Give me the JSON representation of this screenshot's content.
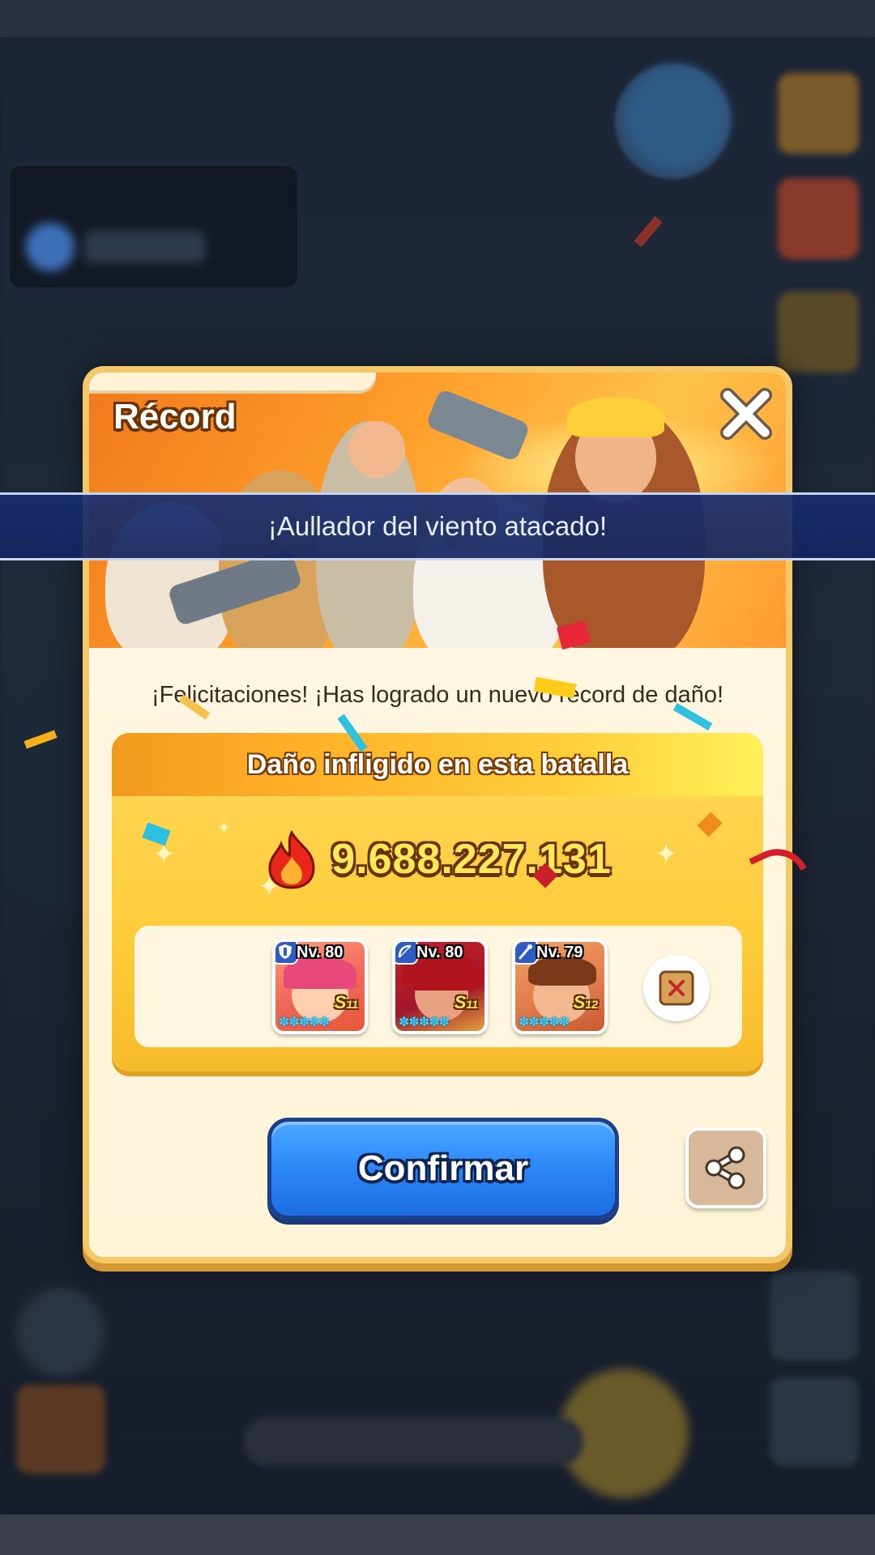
{
  "dialog": {
    "title": "Récord",
    "congrats_text": "¡Felicitaciones! ¡Has logrado un nuevo récord de daño!",
    "damage_label": "Daño infligido en esta batalla",
    "damage_value": "9.688.227.131",
    "confirm_label": "Confirmar"
  },
  "banner": {
    "text": "¡Aullador del viento atacado!"
  },
  "heroes": [
    {
      "level": "Nv. 80",
      "rank": "S",
      "rank_num": "11",
      "class_icon": "shield-icon"
    },
    {
      "level": "Nv. 80",
      "rank": "S",
      "rank_num": "11",
      "class_icon": "bow-icon"
    },
    {
      "level": "Nv. 79",
      "rank": "S",
      "rank_num": "12",
      "class_icon": "staff-icon"
    }
  ],
  "icons": {
    "close": "close-icon",
    "damage": "fire-icon",
    "scroll": "scroll-icon",
    "share": "share-icon"
  },
  "colors": {
    "accent_orange": "#ff9d2a",
    "confirm_blue": "#2a84f4",
    "damage_gold": "#ffcc3a",
    "banner_navy": "#162d6e"
  }
}
